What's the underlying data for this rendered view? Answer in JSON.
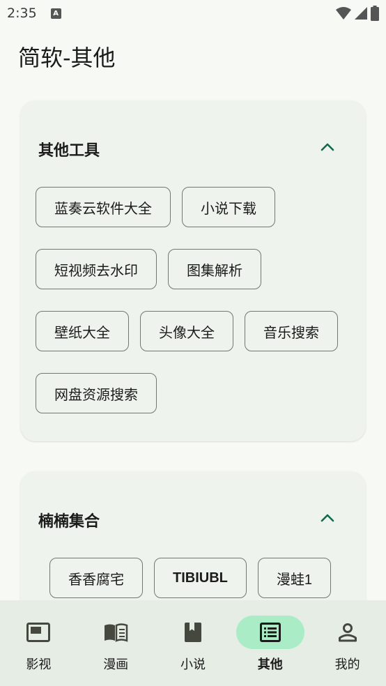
{
  "status_bar": {
    "time": "2:35",
    "app_icon_letter": "A"
  },
  "header": {
    "title": "简软-其他"
  },
  "sections": [
    {
      "title": "其他工具",
      "expanded": true,
      "rows": [
        [
          "蓝奏云软件大全",
          "小说下载"
        ],
        [
          "短视频去水印",
          "图集解析"
        ],
        [
          "壁纸大全",
          "头像大全",
          "音乐搜索"
        ],
        [
          "网盘资源搜索"
        ]
      ]
    },
    {
      "title": "楠楠集合",
      "expanded": true,
      "rows": [
        [
          "香香腐宅",
          "TIBIUBL",
          "漫蛙1"
        ]
      ]
    }
  ],
  "bottom_nav": [
    {
      "label": "影视",
      "icon": "video-icon"
    },
    {
      "label": "漫画",
      "icon": "open-book-icon"
    },
    {
      "label": "小说",
      "icon": "book-icon"
    },
    {
      "label": "其他",
      "icon": "list-icon",
      "active": true
    },
    {
      "label": "我的",
      "icon": "person-icon"
    }
  ],
  "colors": {
    "background": "#f7f9f4",
    "card": "#eef3ed",
    "accent": "#0f6b4a",
    "active_pill": "#a9ecc6",
    "nav_bar": "#e6ede5"
  }
}
